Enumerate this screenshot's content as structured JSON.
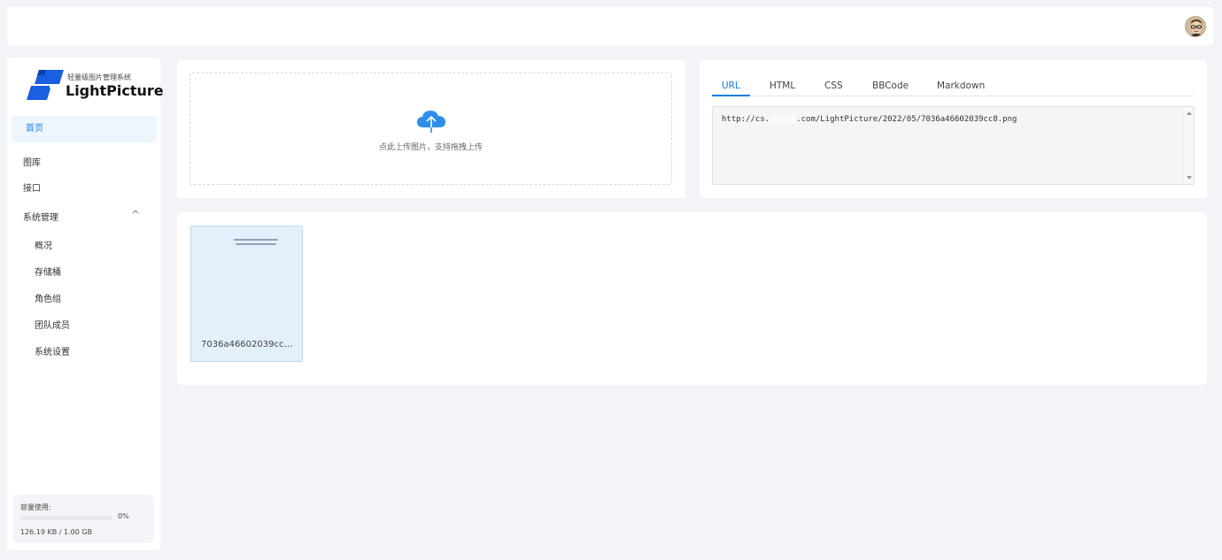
{
  "header": {
    "avatar_icon": "user-avatar"
  },
  "sidebar": {
    "logo": {
      "tagline": "轻量级图片管理系统",
      "name": "LightPicture",
      "accent": "#1a5fe0"
    },
    "items": [
      {
        "label": "首页",
        "active": true
      },
      {
        "label": "图库"
      },
      {
        "label": "接口"
      },
      {
        "label": "系统管理",
        "expanded": true
      }
    ],
    "submenu": [
      "概况",
      "存储桶",
      "角色组",
      "团队成员",
      "系统设置"
    ],
    "quota": {
      "label": "容量使用:",
      "percent_label": "0%",
      "percent": 0,
      "usage": "126.19 KB / 1.00 GB"
    }
  },
  "upload": {
    "icon": "cloud-upload-icon",
    "hint": "点此上传图片，支持拖拽上传"
  },
  "link_panel": {
    "tabs": [
      "URL",
      "HTML",
      "CSS",
      "BBCode",
      "Markdown"
    ],
    "active_tab": "URL",
    "url_prefix": "http://cs.",
    "url_suffix": ".com/LightPicture/2022/05/7036a46602039cc8.png"
  },
  "gallery": {
    "items": [
      {
        "name": "7036a46602039cc8..."
      }
    ]
  },
  "colors": {
    "accent": "#1a7ee6",
    "background": "#f3f4f7"
  }
}
